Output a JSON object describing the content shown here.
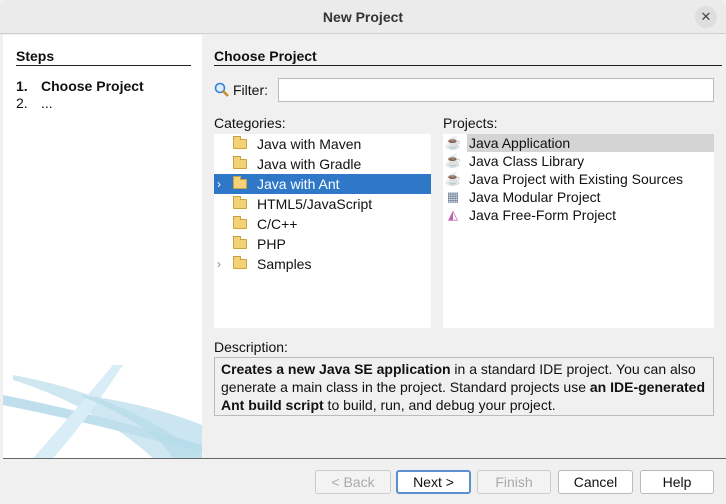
{
  "window": {
    "title": "New Project",
    "close_icon": "close-icon"
  },
  "steps": {
    "heading": "Steps",
    "items": [
      {
        "num": "1.",
        "label": "Choose Project"
      },
      {
        "num": "2.",
        "label": "..."
      }
    ]
  },
  "main": {
    "heading": "Choose Project",
    "filter": {
      "label": "Filter:",
      "value": "",
      "icon": "search-icon"
    },
    "categories": {
      "label": "Categories:",
      "selected": "Java with Ant",
      "items": [
        {
          "label": "Java with Maven",
          "expandable": false
        },
        {
          "label": "Java with Gradle",
          "expandable": false
        },
        {
          "label": "Java with Ant",
          "expandable": true
        },
        {
          "label": "HTML5/JavaScript",
          "expandable": false
        },
        {
          "label": "C/C++",
          "expandable": false
        },
        {
          "label": "PHP",
          "expandable": false
        },
        {
          "label": "Samples",
          "expandable": true
        }
      ]
    },
    "projects": {
      "label": "Projects:",
      "selected": "Java Application",
      "items": [
        {
          "label": "Java Application",
          "icon": "java-cup-icon"
        },
        {
          "label": "Java Class Library",
          "icon": "java-cup-icon"
        },
        {
          "label": "Java Project with Existing Sources",
          "icon": "java-cup-icon"
        },
        {
          "label": "Java Modular Project",
          "icon": "modular-project-icon"
        },
        {
          "label": "Java Free-Form Project",
          "icon": "free-form-icon"
        }
      ]
    },
    "description": {
      "label": "Description:",
      "parts": [
        {
          "text": "Creates a new Java SE application",
          "bold": true
        },
        {
          "text": " in a standard IDE project. You can also generate a main class in the project. Standard projects use ",
          "bold": false
        },
        {
          "text": "an IDE-generated Ant build script",
          "bold": true
        },
        {
          "text": " to build, run, and debug your project.",
          "bold": false
        }
      ]
    }
  },
  "buttons": {
    "back": "< Back",
    "next": "Next >",
    "finish": "Finish",
    "cancel": "Cancel",
    "help": "Help"
  }
}
